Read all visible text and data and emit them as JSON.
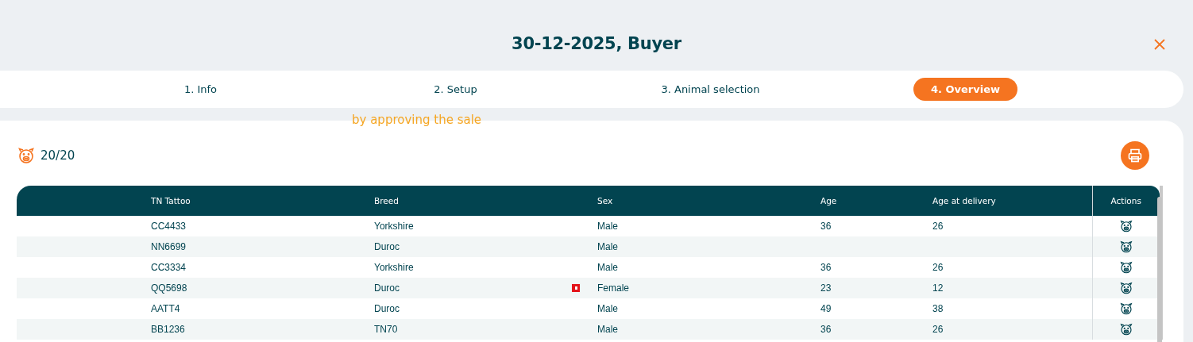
{
  "dialog": {
    "title": "30-12-2025, Buyer"
  },
  "steps": [
    {
      "label": "1. Info",
      "selected": false
    },
    {
      "label": "2. Setup",
      "selected": false
    },
    {
      "label": "3. Animal selection",
      "selected": false
    },
    {
      "label": "4. Overview",
      "selected": true
    }
  ],
  "notice": "by approving the sale",
  "count": "20/20",
  "table": {
    "columns": [
      "TN Tattoo",
      "Breed",
      "Sex",
      "Age",
      "Age at delivery"
    ],
    "actions_column": "Actions",
    "rows": [
      {
        "cells": [
          "CC4433",
          "Yorkshire",
          "Male",
          "36",
          "26"
        ],
        "flagged": false
      },
      {
        "cells": [
          "NN6699",
          "Duroc",
          "Male",
          "",
          ""
        ],
        "flagged": false
      },
      {
        "cells": [
          "CC3334",
          "Yorkshire",
          "Male",
          "36",
          "26"
        ],
        "flagged": false
      },
      {
        "cells": [
          "QQ5698",
          "Duroc",
          "Female",
          "23",
          "12"
        ],
        "flagged": true
      },
      {
        "cells": [
          "AATT4",
          "Duroc",
          "Male",
          "49",
          "38"
        ],
        "flagged": false
      },
      {
        "cells": [
          "BB1236",
          "TN70",
          "Male",
          "36",
          "26"
        ],
        "flagged": false
      }
    ]
  }
}
